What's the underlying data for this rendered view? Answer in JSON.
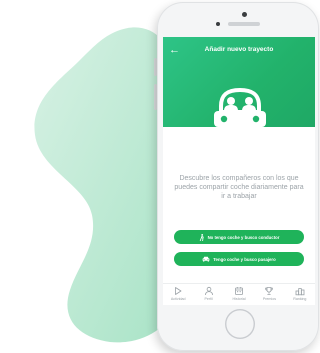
{
  "header": {
    "back_icon": "arrow-left-icon",
    "title": "Añadir nuevo trayecto"
  },
  "hero": {
    "icon": "shared-car-icon"
  },
  "description": "Descubre los compañeros con los que puedes compartir coche diariamente para ir a trabajar",
  "actions": [
    {
      "icon": "walking-person-icon",
      "label": "No tengo coche y busco conductor"
    },
    {
      "icon": "car-icon",
      "label": "Tengo coche y busco pasajero"
    }
  ],
  "tabbar": {
    "items": [
      {
        "icon": "play-icon",
        "label": "Actividad"
      },
      {
        "icon": "user-icon",
        "label": "Perfil"
      },
      {
        "icon": "calendar-icon",
        "label": "Historial"
      },
      {
        "icon": "trophy-icon",
        "label": "Premios"
      },
      {
        "icon": "ranking-icon",
        "label": "Ranking"
      }
    ]
  },
  "colors": {
    "primary_green": "#1fb35a",
    "header_gradient_start": "#2ec487",
    "header_gradient_end": "#1fa865",
    "blob_green": "#a8e3c6",
    "text_gray": "#9ca3a8"
  }
}
